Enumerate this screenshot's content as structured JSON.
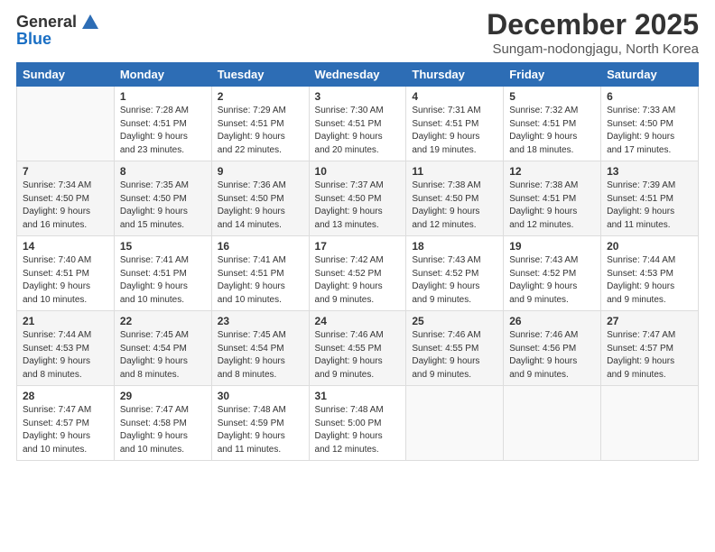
{
  "header": {
    "logo_general": "General",
    "logo_blue": "Blue",
    "month": "December 2025",
    "location": "Sungam-nodongjagu, North Korea"
  },
  "weekdays": [
    "Sunday",
    "Monday",
    "Tuesday",
    "Wednesday",
    "Thursday",
    "Friday",
    "Saturday"
  ],
  "weeks": [
    [
      {
        "day": "",
        "info": ""
      },
      {
        "day": "1",
        "info": "Sunrise: 7:28 AM\nSunset: 4:51 PM\nDaylight: 9 hours\nand 23 minutes."
      },
      {
        "day": "2",
        "info": "Sunrise: 7:29 AM\nSunset: 4:51 PM\nDaylight: 9 hours\nand 22 minutes."
      },
      {
        "day": "3",
        "info": "Sunrise: 7:30 AM\nSunset: 4:51 PM\nDaylight: 9 hours\nand 20 minutes."
      },
      {
        "day": "4",
        "info": "Sunrise: 7:31 AM\nSunset: 4:51 PM\nDaylight: 9 hours\nand 19 minutes."
      },
      {
        "day": "5",
        "info": "Sunrise: 7:32 AM\nSunset: 4:51 PM\nDaylight: 9 hours\nand 18 minutes."
      },
      {
        "day": "6",
        "info": "Sunrise: 7:33 AM\nSunset: 4:50 PM\nDaylight: 9 hours\nand 17 minutes."
      }
    ],
    [
      {
        "day": "7",
        "info": "Sunrise: 7:34 AM\nSunset: 4:50 PM\nDaylight: 9 hours\nand 16 minutes."
      },
      {
        "day": "8",
        "info": "Sunrise: 7:35 AM\nSunset: 4:50 PM\nDaylight: 9 hours\nand 15 minutes."
      },
      {
        "day": "9",
        "info": "Sunrise: 7:36 AM\nSunset: 4:50 PM\nDaylight: 9 hours\nand 14 minutes."
      },
      {
        "day": "10",
        "info": "Sunrise: 7:37 AM\nSunset: 4:50 PM\nDaylight: 9 hours\nand 13 minutes."
      },
      {
        "day": "11",
        "info": "Sunrise: 7:38 AM\nSunset: 4:50 PM\nDaylight: 9 hours\nand 12 minutes."
      },
      {
        "day": "12",
        "info": "Sunrise: 7:38 AM\nSunset: 4:51 PM\nDaylight: 9 hours\nand 12 minutes."
      },
      {
        "day": "13",
        "info": "Sunrise: 7:39 AM\nSunset: 4:51 PM\nDaylight: 9 hours\nand 11 minutes."
      }
    ],
    [
      {
        "day": "14",
        "info": "Sunrise: 7:40 AM\nSunset: 4:51 PM\nDaylight: 9 hours\nand 10 minutes."
      },
      {
        "day": "15",
        "info": "Sunrise: 7:41 AM\nSunset: 4:51 PM\nDaylight: 9 hours\nand 10 minutes."
      },
      {
        "day": "16",
        "info": "Sunrise: 7:41 AM\nSunset: 4:51 PM\nDaylight: 9 hours\nand 10 minutes."
      },
      {
        "day": "17",
        "info": "Sunrise: 7:42 AM\nSunset: 4:52 PM\nDaylight: 9 hours\nand 9 minutes."
      },
      {
        "day": "18",
        "info": "Sunrise: 7:43 AM\nSunset: 4:52 PM\nDaylight: 9 hours\nand 9 minutes."
      },
      {
        "day": "19",
        "info": "Sunrise: 7:43 AM\nSunset: 4:52 PM\nDaylight: 9 hours\nand 9 minutes."
      },
      {
        "day": "20",
        "info": "Sunrise: 7:44 AM\nSunset: 4:53 PM\nDaylight: 9 hours\nand 9 minutes."
      }
    ],
    [
      {
        "day": "21",
        "info": "Sunrise: 7:44 AM\nSunset: 4:53 PM\nDaylight: 9 hours\nand 8 minutes."
      },
      {
        "day": "22",
        "info": "Sunrise: 7:45 AM\nSunset: 4:54 PM\nDaylight: 9 hours\nand 8 minutes."
      },
      {
        "day": "23",
        "info": "Sunrise: 7:45 AM\nSunset: 4:54 PM\nDaylight: 9 hours\nand 8 minutes."
      },
      {
        "day": "24",
        "info": "Sunrise: 7:46 AM\nSunset: 4:55 PM\nDaylight: 9 hours\nand 9 minutes."
      },
      {
        "day": "25",
        "info": "Sunrise: 7:46 AM\nSunset: 4:55 PM\nDaylight: 9 hours\nand 9 minutes."
      },
      {
        "day": "26",
        "info": "Sunrise: 7:46 AM\nSunset: 4:56 PM\nDaylight: 9 hours\nand 9 minutes."
      },
      {
        "day": "27",
        "info": "Sunrise: 7:47 AM\nSunset: 4:57 PM\nDaylight: 9 hours\nand 9 minutes."
      }
    ],
    [
      {
        "day": "28",
        "info": "Sunrise: 7:47 AM\nSunset: 4:57 PM\nDaylight: 9 hours\nand 10 minutes."
      },
      {
        "day": "29",
        "info": "Sunrise: 7:47 AM\nSunset: 4:58 PM\nDaylight: 9 hours\nand 10 minutes."
      },
      {
        "day": "30",
        "info": "Sunrise: 7:48 AM\nSunset: 4:59 PM\nDaylight: 9 hours\nand 11 minutes."
      },
      {
        "day": "31",
        "info": "Sunrise: 7:48 AM\nSunset: 5:00 PM\nDaylight: 9 hours\nand 12 minutes."
      },
      {
        "day": "",
        "info": ""
      },
      {
        "day": "",
        "info": ""
      },
      {
        "day": "",
        "info": ""
      }
    ]
  ]
}
